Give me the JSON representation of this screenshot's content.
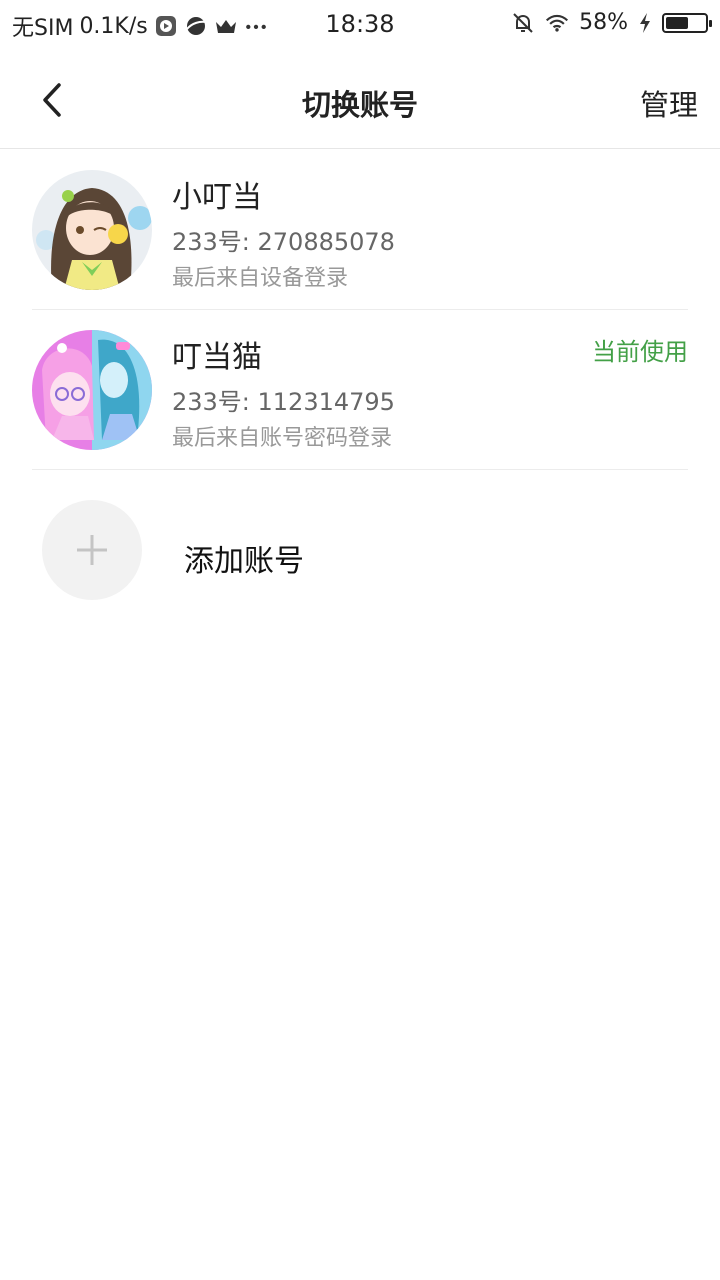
{
  "status_bar": {
    "carrier": "无SIM",
    "speed": "0.1K/s",
    "time": "18:38",
    "battery": "58%",
    "battery_level": 0.58
  },
  "header": {
    "title": "切换账号",
    "manage_label": "管理"
  },
  "accounts": [
    {
      "name": "小叮当",
      "id_text": "233号: 270885078",
      "login_text": "最后来自设备登录",
      "badge": ""
    },
    {
      "name": "叮当猫",
      "id_text": "233号: 112314795",
      "login_text": "最后来自账号密码登录",
      "badge": "当前使用"
    }
  ],
  "add_account": {
    "label": "添加账号"
  },
  "colors": {
    "current_badge": "#43a047",
    "divider": "#ececec"
  }
}
